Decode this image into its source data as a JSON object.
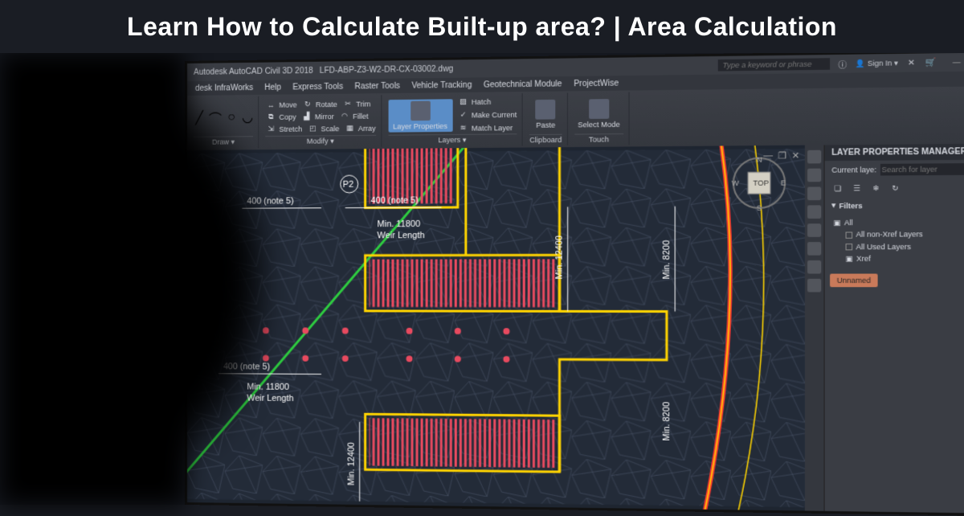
{
  "overlay": {
    "title": "Learn How to Calculate Built-up area? | Area Calculation"
  },
  "app": {
    "product_prefix": "Autodesk AutoCAD Civil 3D 2018",
    "document": "LFD-ABP-Z3-W2-DR-CX-03002.dwg",
    "search_placeholder": "Type a keyword or phrase",
    "signin": "Sign In",
    "window_controls": {
      "min": "—",
      "max": "❐",
      "close": "✕"
    }
  },
  "menubar": [
    "desk InfraWorks",
    "Help",
    "Express Tools",
    "Raster Tools",
    "Vehicle Tracking",
    "Geotechnical Module",
    "ProjectWise"
  ],
  "ribbon": {
    "draw": {
      "label": "Draw ▾"
    },
    "modify": {
      "label": "Modify ▾",
      "items": [
        [
          "Move",
          "Rotate",
          "Trim"
        ],
        [
          "Copy",
          "Mirror",
          "Fillet"
        ],
        [
          "Stretch",
          "Scale",
          "Array"
        ]
      ],
      "icons": [
        [
          "↔",
          "↻",
          "✂"
        ],
        [
          "⧉",
          "▟",
          "◠"
        ],
        [
          "⇲",
          "◰",
          "▦"
        ]
      ]
    },
    "layers": {
      "label": "Layers ▾",
      "big": "Layer Properties",
      "items": [
        "Hatch",
        "Make Current",
        "Match Layer"
      ],
      "icons": [
        "▨",
        "✓",
        "≋"
      ]
    },
    "clipboard": {
      "label": "Clipboard",
      "big": "Paste"
    },
    "touch": {
      "label": "Touch",
      "big": "Select Mode"
    }
  },
  "panel": {
    "title": "LAYER PROPERTIES MANAGER",
    "current_label": "Current laye:",
    "search_placeholder": "Search for layer",
    "filters_label": "Filters",
    "tree": [
      "All",
      "All non-Xref Layers",
      "All Used Layers",
      "Xref"
    ],
    "chip": "Unnamed"
  },
  "compass": {
    "top": "TOP",
    "n": "N",
    "s": "S",
    "e": "E",
    "w": "W"
  },
  "drawing": {
    "p2": "P2",
    "note_a": "400 (note 5)",
    "note_b": "400 (note 5)",
    "note_c": "400 (note 5)",
    "min_11800_a": "Min. 11800",
    "min_11800_b": "Min. 11800",
    "weir_a": "Weir Length",
    "weir_b": "Weir Length",
    "min_12400_a": "Min. 12400",
    "min_12400_b": "Min. 12400",
    "min_8200_a": "Min. 8200",
    "min_8200_b": "Min. 8200"
  }
}
